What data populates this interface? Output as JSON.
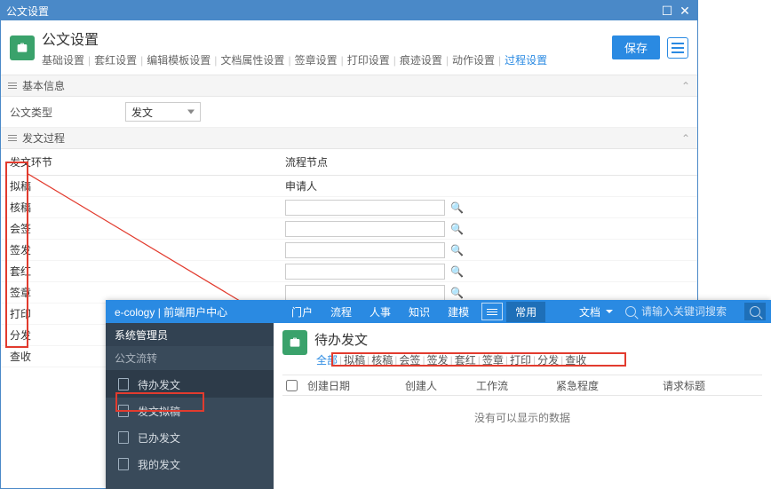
{
  "dialog": {
    "title": "公文设置",
    "page_title": "公文设置",
    "tabs": [
      "基础设置",
      "套红设置",
      "编辑模板设置",
      "文档属性设置",
      "签章设置",
      "打印设置",
      "痕迹设置",
      "动作设置",
      "过程设置"
    ],
    "active_tab": 8,
    "save_label": "保存"
  },
  "sections": {
    "basic": "基本信息",
    "process": "发文过程"
  },
  "fields": {
    "doc_type_label": "公文类型",
    "doc_type_value": "发文"
  },
  "grid": {
    "col1": "发文环节",
    "col2": "流程节点",
    "rows": [
      {
        "stage": "拟稿",
        "node": "申请人",
        "has_input": false
      },
      {
        "stage": "核稿",
        "node": "",
        "has_input": true
      },
      {
        "stage": "会签",
        "node": "",
        "has_input": true
      },
      {
        "stage": "签发",
        "node": "",
        "has_input": true
      },
      {
        "stage": "套红",
        "node": "",
        "has_input": true
      },
      {
        "stage": "签章",
        "node": "",
        "has_input": true
      },
      {
        "stage": "打印",
        "node": "",
        "has_input": true
      },
      {
        "stage": "分发",
        "node": "",
        "has_input": true
      },
      {
        "stage": "查收",
        "node": "",
        "has_input": true
      }
    ]
  },
  "portal": {
    "brand": "e-cology | 前端用户中心",
    "admin": "系统管理员",
    "side_group": "公文流转",
    "side_items": [
      "待办发文",
      "发文拟稿",
      "已办发文",
      "我的发文"
    ],
    "side_active": 0,
    "topnav": [
      "门户",
      "流程",
      "人事",
      "知识",
      "建模"
    ],
    "top_common": "常用",
    "top_doc": "文档",
    "search_placeholder": "请输入关键词搜索",
    "page_title": "待办发文",
    "page_tabs": [
      "全部",
      "拟稿",
      "核稿",
      "会签",
      "签发",
      "套红",
      "签章",
      "打印",
      "分发",
      "查收"
    ],
    "page_tab_active": 0,
    "columns": [
      "创建日期",
      "创建人",
      "工作流",
      "紧急程度",
      "请求标题"
    ],
    "no_data": "没有可以显示的数据"
  }
}
